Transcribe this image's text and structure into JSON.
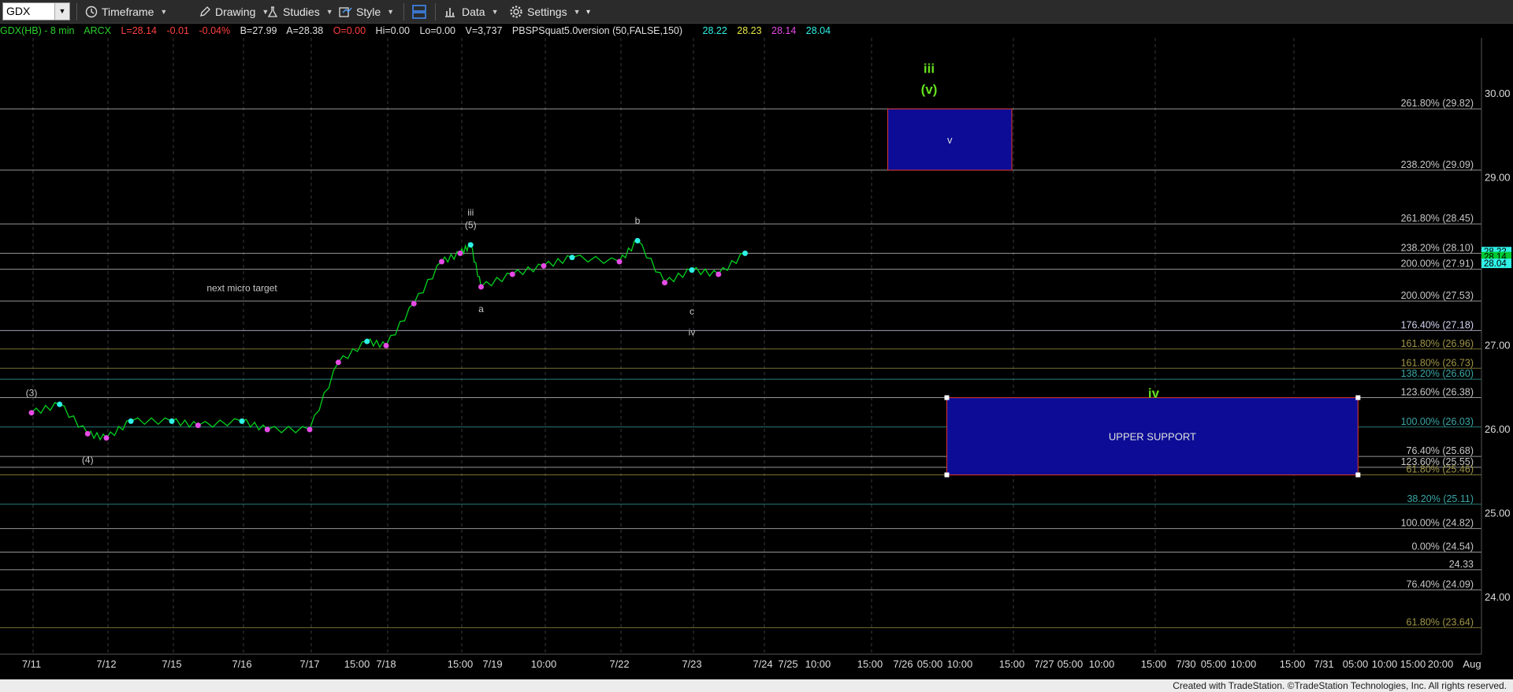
{
  "toolbar": {
    "symbol": "GDX",
    "timeframe": "Timeframe",
    "drawing": "Drawing",
    "studies": "Studies",
    "style": "Style",
    "data": "Data",
    "settings": "Settings"
  },
  "infobar": {
    "symbol": "GDX(HB) - 8 min",
    "exchange": "ARCX",
    "last": "L=28.14",
    "change": "-0.01",
    "pct_change": "-0.04%",
    "bid": "B=27.99",
    "ask": "A=28.38",
    "open": "O=0.00",
    "high": "Hi=0.00",
    "low": "Lo=0.00",
    "volume": "V=3,737",
    "study": "PBSPSquat5.0version (50,FALSE,150)",
    "v1": "28.22",
    "v2": "28.23",
    "v3": "28.14",
    "v4": "28.04"
  },
  "colors": {
    "background": "#000000",
    "price_line": "#00d21e",
    "high_dot": "#2ff1e6",
    "low_dot": "#e64be6",
    "fib_white": "#c8c8c8",
    "fib_olive": "#a09646",
    "fib_teal": "#3aa6a6",
    "box_fill": "#0c0c96",
    "box_border": "#c83232",
    "wave_green": "#64e01e",
    "label_gray": "#c8c8c8"
  },
  "chart_data": {
    "type": "line",
    "title": "",
    "xlabel": "",
    "ylabel": "",
    "ylim": [
      23.3,
      30.5
    ],
    "y_ticks": [
      "30.00",
      "29.00",
      "28.00",
      "27.00",
      "26.00",
      "25.00",
      "24.00"
    ],
    "x_ticks": [
      "7/11",
      "7/12",
      "7/15",
      "7/16",
      "7/17",
      "15:00",
      "7/18",
      "15:00",
      "7/19",
      "10:00",
      "7/22",
      "7/23",
      "7/24",
      "7/25",
      "10:00",
      "15:00",
      "7/26",
      "05:00",
      "10:00",
      "15:00",
      "7/27",
      "05:00",
      "10:00",
      "15:00",
      "7/30",
      "05:00",
      "10:00",
      "15:00",
      "7/31",
      "05:00",
      "10:00",
      "15:00",
      "20:00",
      "Aug"
    ],
    "price_series": {
      "name": "",
      "x": [
        "7/11",
        "7/11 12:00",
        "7/11 15:00",
        "7/12",
        "7/12 12:00",
        "7/15",
        "7/15 12:00",
        "7/16",
        "7/16 12:00",
        "7/17",
        "7/17 12:00",
        "7/17 15:00",
        "7/18",
        "7/18 12:00",
        "7/18 15:00",
        "7/19",
        "7/19 10:00",
        "7/19 11:00",
        "7/19 14:00",
        "7/22",
        "7/22 12:00",
        "7/23",
        "7/23 11:00",
        "7/23 14:00",
        "7/24",
        "7/24 12:00",
        "7/24 15:00"
      ],
      "values": [
        26.2,
        26.3,
        25.95,
        25.9,
        26.1,
        26.1,
        26.05,
        26.1,
        26.0,
        26.0,
        26.8,
        27.05,
        27.0,
        27.5,
        28.0,
        28.1,
        28.2,
        27.7,
        27.85,
        27.95,
        28.05,
        28.0,
        28.25,
        27.75,
        27.9,
        27.85,
        28.1
      ]
    },
    "fib_levels": [
      {
        "label": "261.80% (29.82)",
        "value": 29.82,
        "color": "#c8c8c8"
      },
      {
        "label": "238.20% (29.09)",
        "value": 29.09,
        "color": "#c8c8c8"
      },
      {
        "label": "261.80% (28.45)",
        "value": 28.45,
        "color": "#c8c8c8"
      },
      {
        "label": "238.20% (28.10)",
        "value": 28.1,
        "color": "#c8c8c8"
      },
      {
        "label": "200.00% (27.91)",
        "value": 27.91,
        "color": "#c8c8c8"
      },
      {
        "label": "200.00% (27.53)",
        "value": 27.53,
        "color": "#c8c8c8"
      },
      {
        "label": "176.40% (27.18)",
        "value": 27.18,
        "color": "#d2d2f0"
      },
      {
        "label": "161.80% (26.96)",
        "value": 26.96,
        "color": "#a09646"
      },
      {
        "label": "161.80% (26.73)",
        "value": 26.73,
        "color": "#a09646"
      },
      {
        "label": "138.20% (26.60)",
        "value": 26.6,
        "color": "#3aa6a6"
      },
      {
        "label": "123.60% (26.38)",
        "value": 26.38,
        "color": "#c8c8c8"
      },
      {
        "label": "100.00% (26.03)",
        "value": 26.03,
        "color": "#3aa6a6"
      },
      {
        "label": "76.40% (25.68)",
        "value": 25.68,
        "color": "#c8c8c8"
      },
      {
        "label": "123.60% (25.55)",
        "value": 25.55,
        "color": "#c8c8c8"
      },
      {
        "label": "61.80% (25.46)",
        "value": 25.46,
        "color": "#a09646"
      },
      {
        "label": "38.20% (25.11)",
        "value": 25.11,
        "color": "#3aa6a6"
      },
      {
        "label": "100.00% (24.82)",
        "value": 24.82,
        "color": "#c8c8c8"
      },
      {
        "label": "0.00% (24.54)",
        "value": 24.54,
        "color": "#c8c8c8"
      },
      {
        "label": "24.33",
        "value": 24.33,
        "color": "#c8c8c8"
      },
      {
        "label": "76.40% (24.09)",
        "value": 24.09,
        "color": "#c8c8c8"
      },
      {
        "label": "61.80% (23.64)",
        "value": 23.64,
        "color": "#a09646"
      }
    ],
    "target_boxes": [
      {
        "name": "wave-v-target",
        "label": "v",
        "x_from": "7/26 03:00",
        "x_to": "7/27 00:00",
        "y_from": 29.09,
        "y_to": 29.82
      },
      {
        "name": "upper-support",
        "label": "UPPER SUPPORT",
        "x_from": "7/26 13:00",
        "x_to": "7/31 10:00",
        "y_from": 25.46,
        "y_to": 26.38
      }
    ],
    "wave_labels": [
      {
        "text": "(3)",
        "x": "7/11",
        "y": 26.4,
        "color": "#c8c8c8"
      },
      {
        "text": "(4)",
        "x": "7/11 15:00",
        "y": 25.6,
        "color": "#c8c8c8"
      },
      {
        "text": "iii",
        "x": "7/19 10:00",
        "y": 28.55,
        "color": "#c8c8c8"
      },
      {
        "text": "(5)",
        "x": "7/19 10:00",
        "y": 28.4,
        "color": "#c8c8c8"
      },
      {
        "text": "a",
        "x": "7/19 11:00",
        "y": 27.4,
        "color": "#c8c8c8"
      },
      {
        "text": "b",
        "x": "7/23 11:00",
        "y": 28.45,
        "color": "#c8c8c8"
      },
      {
        "text": "c",
        "x": "7/24",
        "y": 27.37,
        "color": "#c8c8c8"
      },
      {
        "text": "iv",
        "x": "7/24",
        "y": 27.12,
        "color": "#c8c8c8"
      },
      {
        "text": "iii",
        "x": "7/26 10:00",
        "y": 30.25,
        "color": "#64e01e"
      },
      {
        "text": "(v)",
        "x": "7/26 10:00",
        "y": 30.0,
        "color": "#64e01e"
      },
      {
        "text": "iv",
        "x": "7/30",
        "y": 26.38,
        "color": "#64e01e"
      },
      {
        "text": "next micro target",
        "x": "7/16",
        "y": 27.65,
        "color": "#c8c8c8"
      }
    ],
    "last_prices": [
      "28.22",
      "28.14",
      "28.04"
    ],
    "grid": "vertical-dashed",
    "legend": "none"
  },
  "credit": "Created with TradeStation. ©TradeStation Technologies, Inc. All rights reserved."
}
